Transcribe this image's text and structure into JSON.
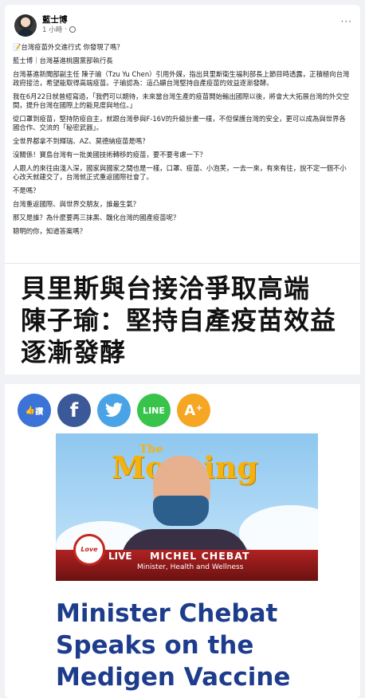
{
  "post": {
    "author": "藍士博",
    "time": "1 小時",
    "more": "···",
    "paragraphs": [
      "📝台灣疫苗外交進行式 你發現了嗎？",
      "藍士博｜台灣基進桃園黨部執行長",
      "台灣基進新聞部副主任 陳子瑜（Tzu Yu Chen）引用外媒，指出貝里斯衛生福利部長上節目時透露，正積極向台灣政府接洽，希望能取得高端疫苗。子瑜認為：這凸顯台灣堅持自產疫苗的效益逐漸發酵。",
      "我在6月22日就曾經寫過，「我們可以期待，未來當台灣生產的疫苗開始輸出國際以後，將會大大拓展台灣的外交空間，提升台灣在國際上的能見度與地位。」",
      "從口罩到疫苗，堅持防疫自主，就跟台灣參與F-16V的升級計畫一樣，不但保護台灣的安全，更可以成為與世界各國合作、交流的「秘密武器」。",
      "全世界都拿不到輝瑞、AZ、莫德納疫苗是嗎？",
      "沒關係！寶島台灣有一批美國技術轉移的疫苗，要不要考慮一下？",
      "人跟人的來往由淺入深，國家與國家之間也是一樣，口罩、疫苗、小泡芙，一去一來，有來有往，說不定一個不小心改天就建交了，台灣就正式重返國際社會了。",
      "不是嗎？",
      "台灣重返國際、與世界交朋友，誰最生氣？",
      "那又是誰？為什麼要再三抹黑、醜化台灣的國產疫苗呢？",
      "聰明的你，知道答案嗎？"
    ]
  },
  "banner": {
    "line1": "貝里斯與台接洽爭取高端",
    "line2": "陳子瑜：堅持自產疫苗效益",
    "line3": "逐漸發酵"
  },
  "share": {
    "like_label": "讚",
    "fb_label": "f",
    "line_label": "LINE",
    "aplus_label": "A⁺"
  },
  "video": {
    "show_the": "The",
    "show_name": "Morning",
    "live": "LIVE",
    "logo": "Love",
    "guest_name": "MICHEL CHEBAT",
    "guest_title": "Minister, Health and Wellness"
  },
  "article": {
    "title": "Minister Chebat Speaks on the Medigen Vaccine"
  }
}
